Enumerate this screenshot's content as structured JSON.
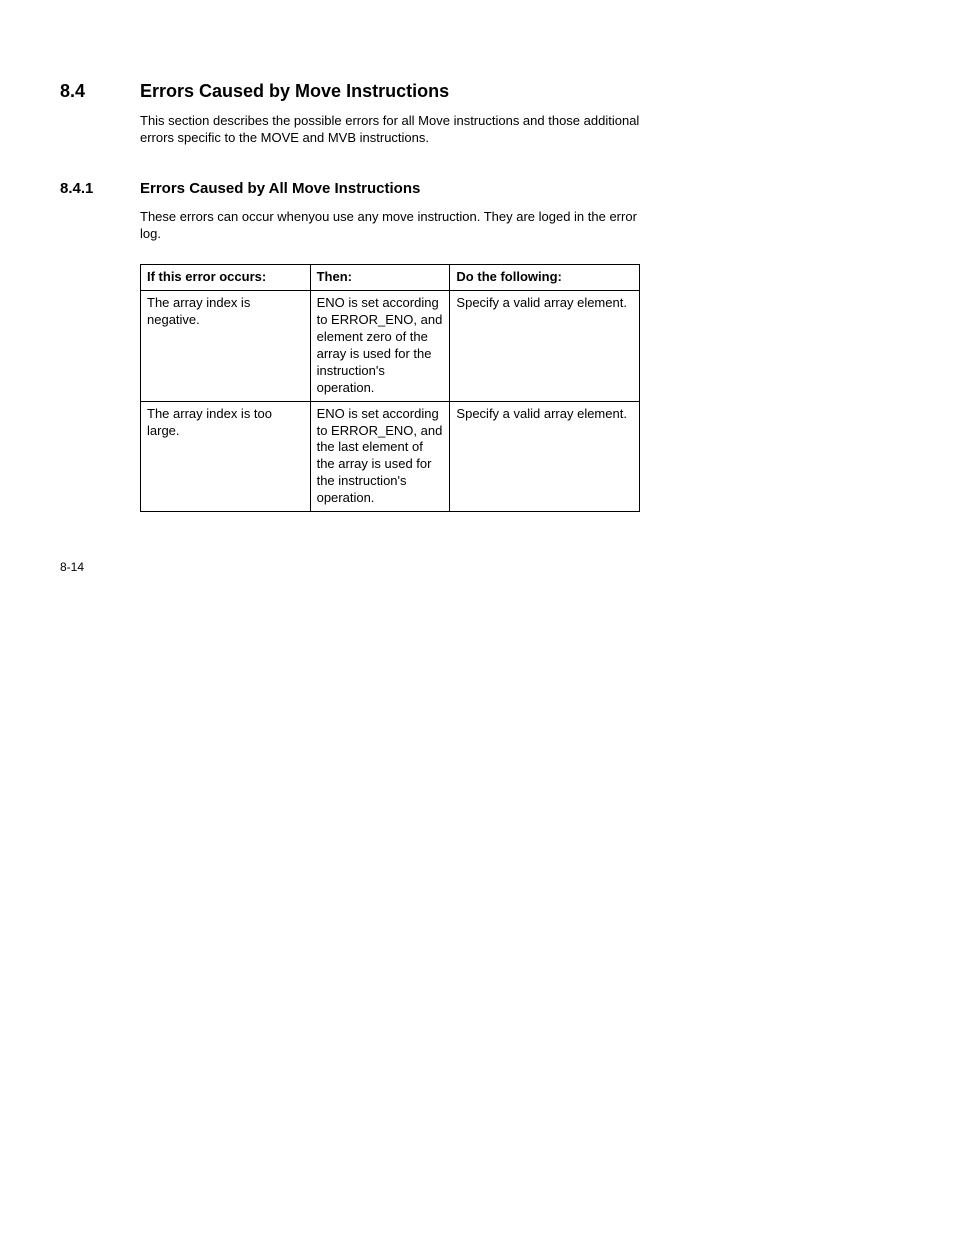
{
  "section": {
    "number": "8.4",
    "title": "Errors Caused by Move Instructions",
    "intro": "This section describes the possible errors for all Move instructions and those additional errors specific to the MOVE and MVB instructions."
  },
  "subsection": {
    "number": "8.4.1",
    "title": "Errors Caused by All Move Instructions",
    "intro": "These errors can occur whenyou use any move instruction. They are loged in the error log."
  },
  "table": {
    "headers": [
      "If this error occurs:",
      "Then:",
      "Do the following:"
    ],
    "rows": [
      [
        "The array index is negative.",
        "ENO is set according to ERROR_ENO, and element zero of the array is used for the instruction's operation.",
        "Specify a valid array element."
      ],
      [
        "The array index is too large.",
        "ENO is set according to ERROR_ENO, and the last element of the array is used for the instruction's operation.",
        "Specify a valid array element."
      ]
    ]
  },
  "page_number": "8-14"
}
